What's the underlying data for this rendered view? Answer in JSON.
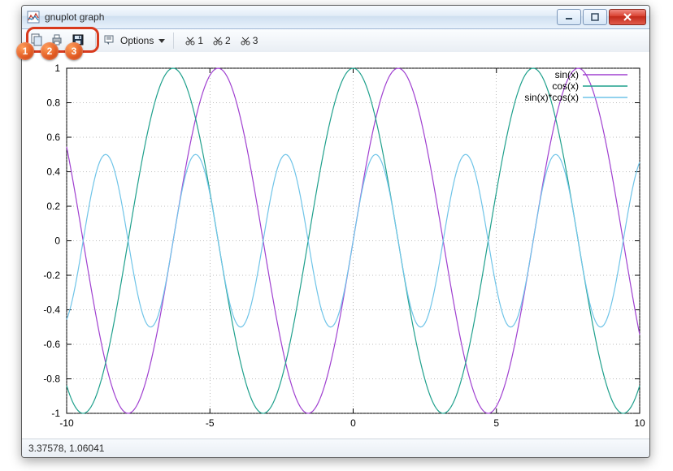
{
  "window": {
    "title": "gnuplot graph"
  },
  "toolbar": {
    "options_label": "Options",
    "scissors": [
      "1",
      "2",
      "3"
    ]
  },
  "annotations": {
    "badges": [
      "1",
      "2",
      "3"
    ]
  },
  "status": {
    "coords": "3.37578, 1.06041"
  },
  "chart_data": {
    "type": "line",
    "xlabel": "",
    "ylabel": "",
    "xlim": [
      -10,
      10
    ],
    "ylim": [
      -1,
      1
    ],
    "xticks": [
      -10,
      -5,
      0,
      5,
      10
    ],
    "yticks": [
      -1,
      -0.8,
      -0.6,
      -0.4,
      -0.2,
      0,
      0.2,
      0.4,
      0.6,
      0.8,
      1
    ],
    "grid": true,
    "legend_position": "top-right",
    "series": [
      {
        "name": "sin(x)",
        "color": "#a040d0",
        "fn": "sin"
      },
      {
        "name": "cos(x)",
        "color": "#1fa08c",
        "fn": "cos"
      },
      {
        "name": "sin(x)*cos(x)",
        "color": "#6fc4e8",
        "fn": "sincos"
      }
    ]
  }
}
